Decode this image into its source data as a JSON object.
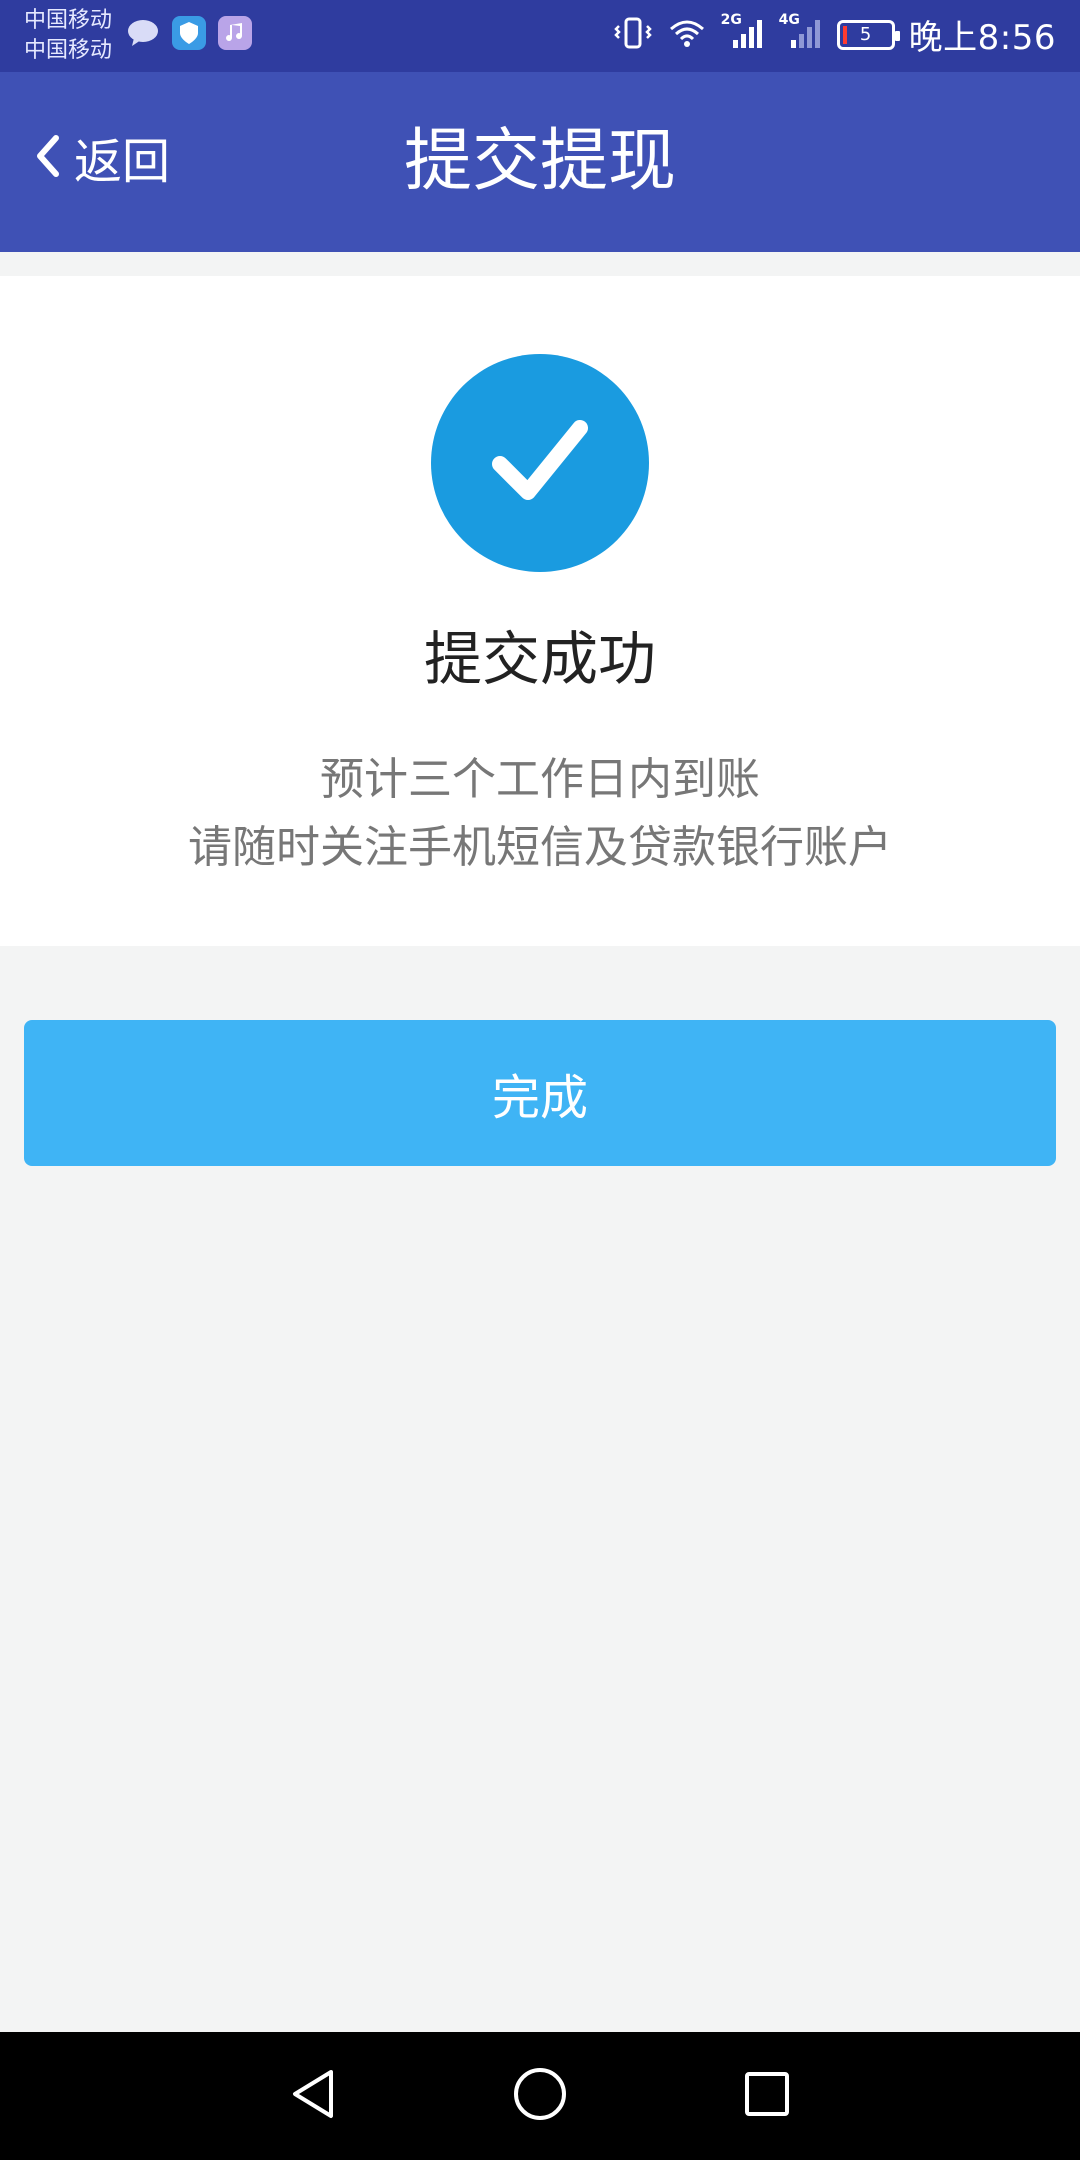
{
  "status_bar": {
    "carrier_1": "中国移动",
    "carrier_2": "中国移动",
    "network_1": "2G",
    "network_2": "4G",
    "battery_level": "5",
    "time": "晚上8:56"
  },
  "header": {
    "back_label": "返回",
    "title": "提交提现"
  },
  "result": {
    "status_title": "提交成功",
    "line_1": "预计三个工作日内到账",
    "line_2": "请随时关注手机短信及贷款银行账户"
  },
  "actions": {
    "done_label": "完成"
  },
  "colors": {
    "status_bar_bg": "#2f3c9f",
    "nav_bg": "#3f51b5",
    "check_circle": "#1a9be0",
    "button_bg": "#3fb4f5",
    "page_bg": "#f3f4f4"
  },
  "icons": {
    "check": "check-icon",
    "back": "chevron-left-icon",
    "nav_back": "triangle-back-icon",
    "nav_home": "circle-home-icon",
    "nav_recent": "square-recent-icon"
  }
}
